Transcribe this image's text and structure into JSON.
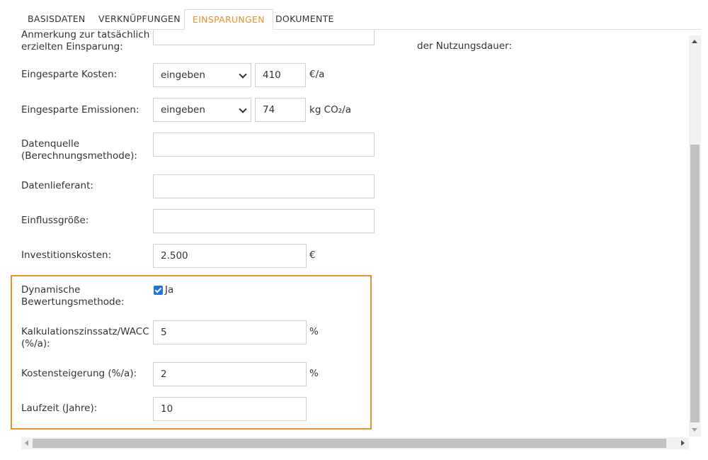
{
  "tabs": [
    "BASISDATEN",
    "VERKNÜPFUNGEN",
    "EINSPARUNGEN",
    "DOKUMENTE"
  ],
  "active_tab": "EINSPARUNGEN",
  "form": {
    "partial_label_line1": "Anmerkung zur tatsächlich",
    "partial_label_line2": "erzielten Einsparung:",
    "eingesparte_kosten": {
      "label": "Eingesparte Kosten:",
      "mode": "eingeben",
      "value": "410",
      "unit": "€/a"
    },
    "eingesparte_emissionen": {
      "label": "Eingesparte Emissionen:",
      "mode": "eingeben",
      "value": "74",
      "unit": "kg CO₂/a"
    },
    "datenquelle": {
      "label_line1": "Datenquelle",
      "label_line2": "(Berechnungsmethode):",
      "value": ""
    },
    "datenlieferant": {
      "label": "Datenlieferant:",
      "value": ""
    },
    "einflussgroesse": {
      "label": "Einflussgröße:",
      "value": ""
    },
    "investitionskosten": {
      "label": "Investitionskosten:",
      "value": "2.500",
      "unit": "€"
    },
    "dynamische_bewertung": {
      "label_line1": "Dynamische",
      "label_line2": "Bewertungsmethode:",
      "checked": true,
      "checkbox_label": "Ja"
    },
    "kalkulationszinssatz": {
      "label_line1": "Kalkulationszinssatz/WACC",
      "label_line2": "(%/a):",
      "value": "5",
      "unit": "%"
    },
    "kostensteigerung": {
      "label": "Kostensteigerung (%/a):",
      "value": "2",
      "unit": "%"
    },
    "laufzeit": {
      "label": "Laufzeit (Jahre):",
      "value": "10"
    }
  },
  "right_column": {
    "partial_text": "der Nutzungsdauer:"
  },
  "colors": {
    "accent": "#e8902a",
    "checkbox": "#1a73e8"
  }
}
